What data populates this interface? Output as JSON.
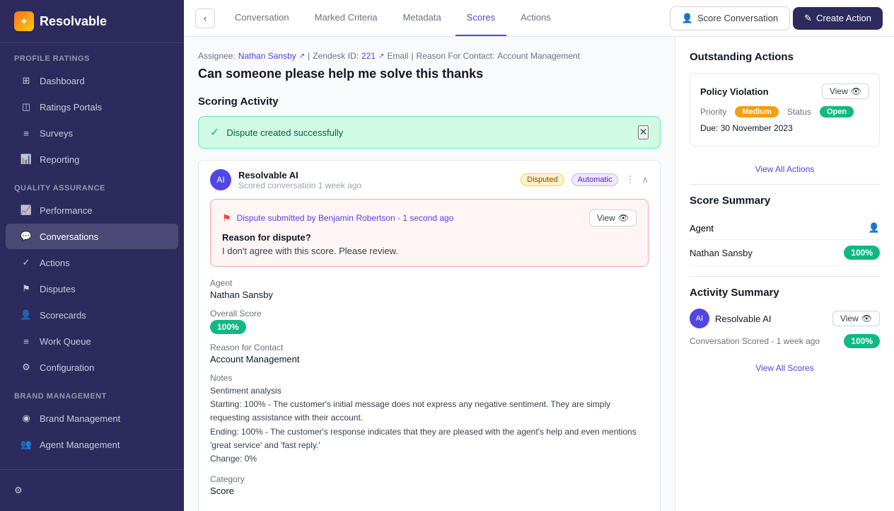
{
  "sidebar": {
    "logo_text": "Resolvable",
    "sections": [
      {
        "label": "Profile Ratings",
        "items": [
          {
            "id": "dashboard",
            "label": "Dashboard",
            "icon": "⊞"
          },
          {
            "id": "ratings-portals",
            "label": "Ratings Portals",
            "icon": "◫"
          },
          {
            "id": "surveys",
            "label": "Surveys",
            "icon": "≡"
          },
          {
            "id": "reporting",
            "label": "Reporting",
            "icon": "📊"
          }
        ]
      },
      {
        "label": "Quality Assurance",
        "items": [
          {
            "id": "performance",
            "label": "Performance",
            "icon": "📈"
          },
          {
            "id": "conversations",
            "label": "Conversations",
            "icon": "💬",
            "active": true
          },
          {
            "id": "actions",
            "label": "Actions",
            "icon": "✓"
          },
          {
            "id": "disputes",
            "label": "Disputes",
            "icon": "⚑"
          },
          {
            "id": "scorecards",
            "label": "Scorecards",
            "icon": "👤"
          },
          {
            "id": "work-queue",
            "label": "Work Queue",
            "icon": "≡"
          },
          {
            "id": "configuration",
            "label": "Configuration",
            "icon": "⚙"
          }
        ]
      },
      {
        "label": "Brand Management",
        "items": [
          {
            "id": "brand-management",
            "label": "Brand Management",
            "icon": "◉"
          },
          {
            "id": "agent-management",
            "label": "Agent Management",
            "icon": "👥"
          }
        ]
      }
    ],
    "gear_label": "Settings"
  },
  "tabs": {
    "back_title": "Back",
    "items": [
      {
        "id": "conversation",
        "label": "Conversation",
        "active": false
      },
      {
        "id": "marked-criteria",
        "label": "Marked Criteria",
        "active": false
      },
      {
        "id": "metadata",
        "label": "Metadata",
        "active": false
      },
      {
        "id": "scores",
        "label": "Scores",
        "active": true
      },
      {
        "id": "actions",
        "label": "Actions",
        "active": false
      }
    ],
    "score_btn": "Score Conversation",
    "create_btn": "Create Action"
  },
  "conversation": {
    "assignee_label": "Assignee:",
    "assignee_name": "Nathan Sansby",
    "zendesk_label": "Zendesk ID:",
    "zendesk_id": "221",
    "channel": "Email",
    "reason_label": "Reason For Contact:",
    "reason_value": "Account Management",
    "title": "Can someone please help me solve this thanks"
  },
  "scoring_activity": {
    "section_title": "Scoring Activity",
    "success_banner": "Dispute created successfully",
    "scorer_name": "Resolvable AI",
    "scored_time": "Scored conversation 1 week ago",
    "badge_disputed": "Disputed",
    "badge_automatic": "Automatic",
    "dispute": {
      "submitter": "Dispute submitted by Benjamin Robertson - 1 second ago",
      "view_label": "View",
      "reason_label": "Reason for dispute?",
      "reason_text": "I don't agree with this score. Please review."
    },
    "agent_label": "Agent",
    "agent_name": "Nathan Sansby",
    "overall_score_label": "Overall Score",
    "overall_score_badge": "100%",
    "reason_contact_label": "Reason for Contact",
    "reason_contact_value": "Account Management",
    "notes_label": "Notes",
    "notes_text": "Sentiment analysis\nStarting: 100% - The customer's initial message does not express any negative sentiment. They are simply requesting assistance with their account.\nEnding: 100% - The customer's response indicates that they are pleased with the agent's help and even mentions 'great service' and 'fast reply.'\nChange: 0%",
    "category_label": "Category",
    "category_stub": "Score"
  },
  "outstanding_actions": {
    "section_title": "Outstanding Actions",
    "card": {
      "title": "Policy Violation",
      "view_label": "View",
      "priority_label": "Priority",
      "priority_value": "Medium",
      "status_label": "Status",
      "status_value": "Open",
      "due_label": "Due:",
      "due_value": "30 November 2023"
    },
    "view_all_label": "View All Actions"
  },
  "score_summary": {
    "section_title": "Score Summary",
    "agent_label": "Agent",
    "agent_name": "Nathan Sansby",
    "score_badge": "100%"
  },
  "activity_summary": {
    "section_title": "Activity Summary",
    "scorer_name": "Resolvable AI",
    "view_label": "View",
    "activity_detail": "Conversation Scored - 1 week ago",
    "score_badge": "100%",
    "view_all_label": "View All Scores"
  }
}
